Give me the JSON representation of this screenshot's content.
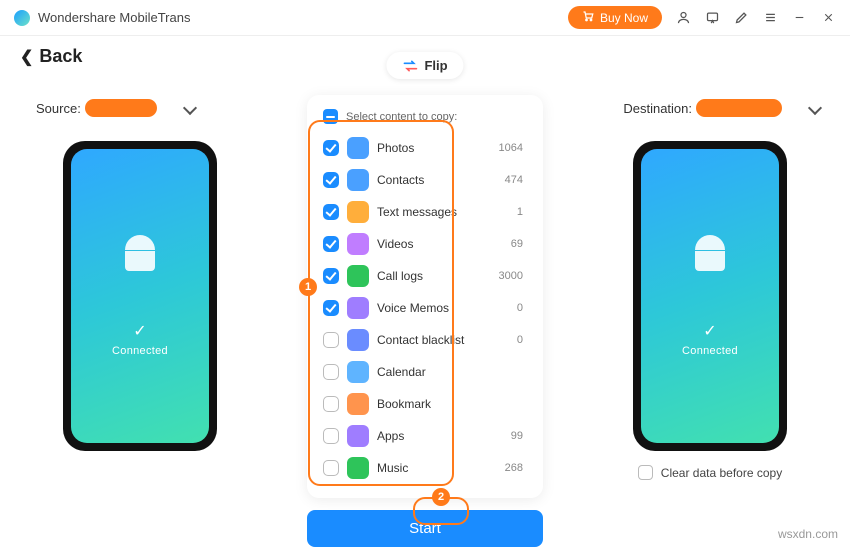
{
  "app_title": "Wondershare MobileTrans",
  "buy_label": "Buy Now",
  "back_label": "Back",
  "flip_label": "Flip",
  "source_label": "Source:",
  "destination_label": "Destination:",
  "connected_label": "Connected",
  "panel_header": "Select content to copy:",
  "start_label": "Start",
  "clear_label": "Clear data before copy",
  "watermark": "wsxdn.com",
  "items": [
    {
      "name": "Photos",
      "count": "1064",
      "checked": true,
      "color": "#4aa0ff"
    },
    {
      "name": "Contacts",
      "count": "474",
      "checked": true,
      "color": "#4aa0ff"
    },
    {
      "name": "Text messages",
      "count": "1",
      "checked": true,
      "color": "#ffae3b"
    },
    {
      "name": "Videos",
      "count": "69",
      "checked": true,
      "color": "#c07dff"
    },
    {
      "name": "Call logs",
      "count": "3000",
      "checked": true,
      "color": "#2ec45a"
    },
    {
      "name": "Voice Memos",
      "count": "0",
      "checked": true,
      "color": "#9f7dff"
    },
    {
      "name": "Contact blacklist",
      "count": "0",
      "checked": false,
      "color": "#6a8cff"
    },
    {
      "name": "Calendar",
      "count": "",
      "checked": false,
      "color": "#5fb4ff"
    },
    {
      "name": "Bookmark",
      "count": "",
      "checked": false,
      "color": "#ff944d"
    },
    {
      "name": "Apps",
      "count": "99",
      "checked": false,
      "color": "#9f7dff"
    },
    {
      "name": "Music",
      "count": "268",
      "checked": false,
      "color": "#2ec45a"
    }
  ],
  "annotations": {
    "1": "1",
    "2": "2"
  }
}
